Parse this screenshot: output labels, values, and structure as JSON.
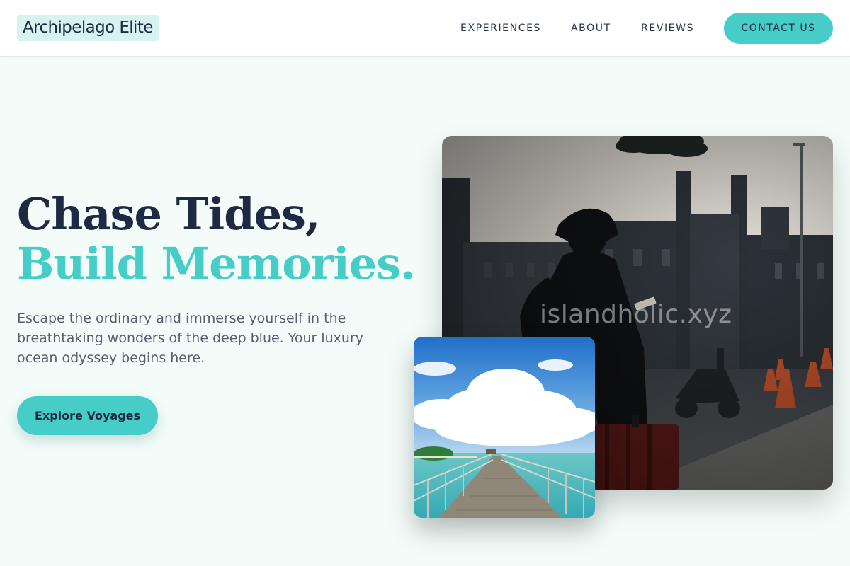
{
  "header": {
    "logo": "Archipelago Elite",
    "nav": [
      {
        "label": "EXPERIENCES"
      },
      {
        "label": "ABOUT"
      },
      {
        "label": "REVIEWS"
      }
    ],
    "cta": "CONTACT US"
  },
  "hero": {
    "title_line1": "Chase Tides,",
    "title_line2": "Build Memories.",
    "description": "Escape the ordinary and immerse yourself in the breathtaking wonders of the deep blue. Your luxury ocean odyssey begins here.",
    "button": "Explore Voyages"
  },
  "images": {
    "main_watermark": "islandholic.xyz"
  },
  "colors": {
    "accent": "#46cdc8",
    "navy": "#1e2a44",
    "background": "#f3fcf9"
  }
}
